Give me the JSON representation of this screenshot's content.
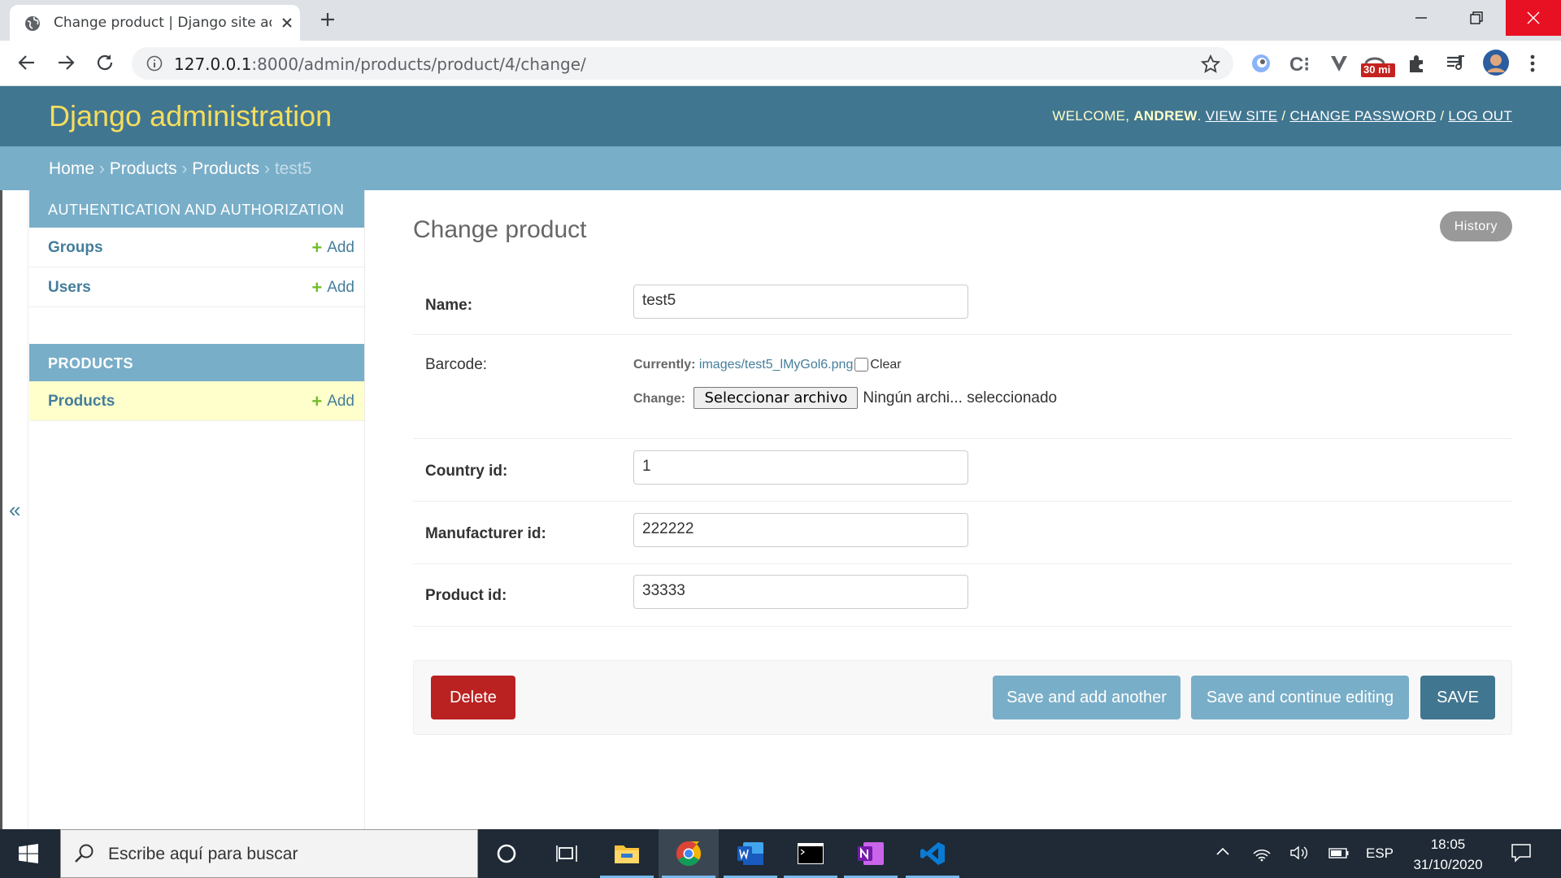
{
  "browser": {
    "tab_title": "Change product | Django site admin",
    "url_host": "127.0.0.1",
    "url_path": ":8000/admin/products/product/4/change/",
    "extension_badge": "30 mi"
  },
  "header": {
    "branding": "Django administration",
    "welcome": "Welcome,",
    "username": "Andrew",
    "view_site": "View site",
    "change_password": "Change password",
    "log_out": "Log out"
  },
  "breadcrumbs": {
    "home": "Home",
    "app": "Products",
    "model": "Products",
    "current": "test5",
    "separator": "›"
  },
  "sidebar": {
    "toggle": "«",
    "modules": [
      {
        "caption": "Authentication and Authorization",
        "rows": [
          {
            "name": "Groups",
            "add": "Add"
          },
          {
            "name": "Users",
            "add": "Add"
          }
        ]
      },
      {
        "caption": "Products",
        "rows": [
          {
            "name": "Products",
            "add": "Add"
          }
        ]
      }
    ]
  },
  "content": {
    "title": "Change product",
    "history": "History",
    "fields": {
      "name": {
        "label": "Name:",
        "value": "test5"
      },
      "barcode": {
        "label": "Barcode:",
        "currently_label": "Currently:",
        "current_file": "images/test5_lMyGol6.png",
        "clear_label": "Clear",
        "change_label": "Change:",
        "file_button": "Seleccionar archivo",
        "no_file": "Ningún archi... seleccionado"
      },
      "country_id": {
        "label": "Country id:",
        "value": "1"
      },
      "manufacturer_id": {
        "label": "Manufacturer id:",
        "value": "222222"
      },
      "product_id": {
        "label": "Product id:",
        "value": "33333"
      }
    },
    "buttons": {
      "delete": "Delete",
      "save_add_another": "Save and add another",
      "save_continue": "Save and continue editing",
      "save": "SAVE"
    }
  },
  "taskbar": {
    "search_placeholder": "Escribe aquí para buscar",
    "language": "ESP",
    "time": "18:05",
    "date": "31/10/2020"
  },
  "colors": {
    "header": "#417690",
    "breadcrumbs": "#79aec8",
    "branding": "#f5dd5d",
    "delete": "#ba2121",
    "save": "#417690",
    "secondary_button": "#79aec8"
  }
}
